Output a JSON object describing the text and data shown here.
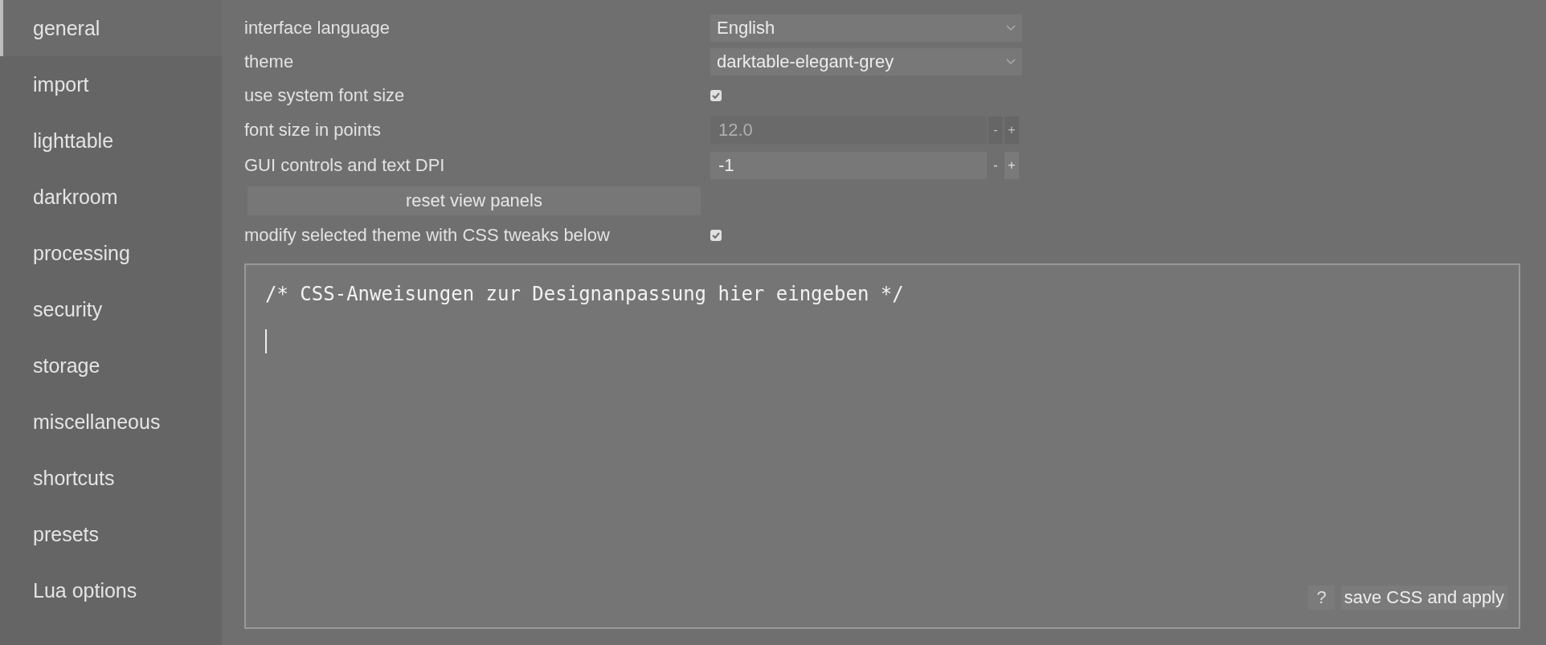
{
  "sidebar": {
    "items": [
      {
        "label": "general",
        "selected": true
      },
      {
        "label": "import",
        "selected": false
      },
      {
        "label": "lighttable",
        "selected": false
      },
      {
        "label": "darkroom",
        "selected": false
      },
      {
        "label": "processing",
        "selected": false
      },
      {
        "label": "security",
        "selected": false
      },
      {
        "label": "storage",
        "selected": false
      },
      {
        "label": "miscellaneous",
        "selected": false
      },
      {
        "label": "shortcuts",
        "selected": false
      },
      {
        "label": "presets",
        "selected": false
      },
      {
        "label": "Lua options",
        "selected": false
      }
    ]
  },
  "settings": [
    {
      "kind": "dropdown",
      "label": "interface language",
      "value": "English"
    },
    {
      "kind": "dropdown",
      "label": "theme",
      "value": "darktable-elegant-grey"
    },
    {
      "kind": "checkbox",
      "label": "use system font size",
      "checked": true
    },
    {
      "kind": "spin",
      "label": "font size in points",
      "value": "12.0",
      "disabled": true,
      "decrement": "-",
      "increment": "+"
    },
    {
      "kind": "spin",
      "label": "GUI controls and text DPI",
      "value": "-1",
      "disabled": false,
      "decrement": "-",
      "increment": "+"
    },
    {
      "kind": "button",
      "label": "reset view panels"
    },
    {
      "kind": "checkbox",
      "label": "modify selected theme with CSS tweaks below",
      "checked": true
    }
  ],
  "css_editor": {
    "text": "/* CSS-Anweisungen zur Designanpassung hier eingeben */",
    "help_button": "?",
    "save_button": "save CSS and apply"
  }
}
